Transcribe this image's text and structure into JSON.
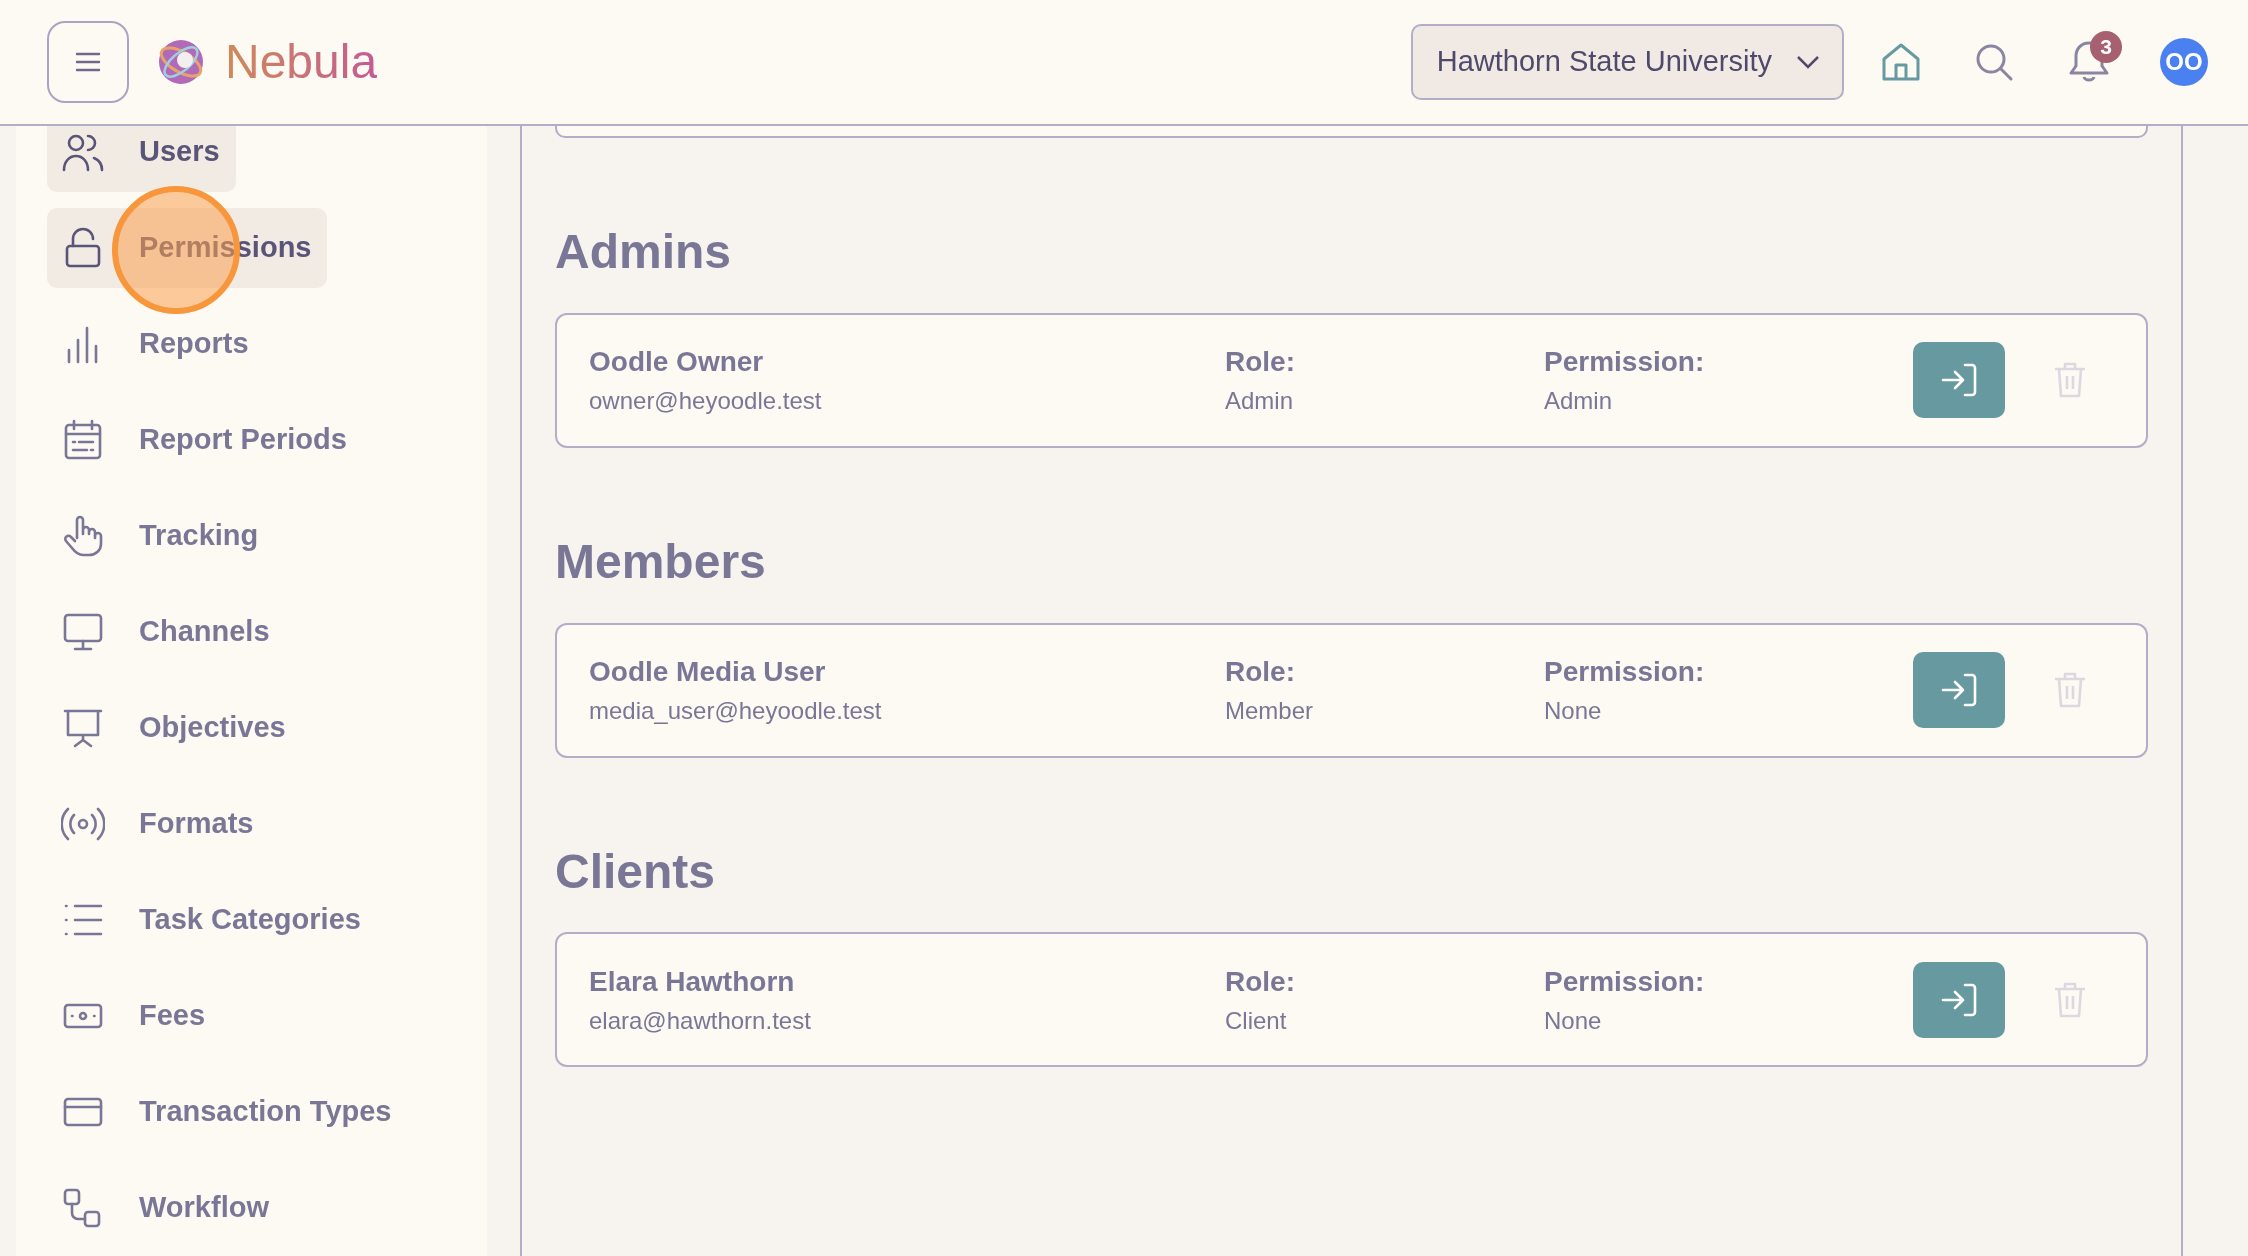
{
  "header": {
    "logo_text": "Nebula",
    "organization": "Hawthorn State University",
    "notification_count": "3",
    "avatar_initials": "OO"
  },
  "sidebar": {
    "items": [
      {
        "label": "Users",
        "selected": true
      },
      {
        "label": "Permissions",
        "selected": true
      },
      {
        "label": "Reports",
        "selected": false
      },
      {
        "label": "Report Periods",
        "selected": false
      },
      {
        "label": "Tracking",
        "selected": false
      },
      {
        "label": "Channels",
        "selected": false
      },
      {
        "label": "Objectives",
        "selected": false
      },
      {
        "label": "Formats",
        "selected": false
      },
      {
        "label": "Task Categories",
        "selected": false
      },
      {
        "label": "Fees",
        "selected": false
      },
      {
        "label": "Transaction Types",
        "selected": false
      },
      {
        "label": "Workflow",
        "selected": false
      }
    ]
  },
  "sections": [
    {
      "title": "Admins",
      "members": [
        {
          "name": "Oodle Owner",
          "email": "owner@heyoodle.test",
          "role_label": "Role:",
          "role": "Admin",
          "permission_label": "Permission:",
          "permission": "Admin",
          "delete_disabled": true
        }
      ]
    },
    {
      "title": "Members",
      "members": [
        {
          "name": "Oodle Media User",
          "email": "media_user@heyoodle.test",
          "role_label": "Role:",
          "role": "Member",
          "permission_label": "Permission:",
          "permission": "None",
          "delete_disabled": true
        }
      ]
    },
    {
      "title": "Clients",
      "members": [
        {
          "name": "Elara Hawthorn",
          "email": "elara@hawthorn.test",
          "role_label": "Role:",
          "role": "Client",
          "permission_label": "Permission:",
          "permission": "None",
          "delete_disabled": true
        }
      ]
    }
  ]
}
